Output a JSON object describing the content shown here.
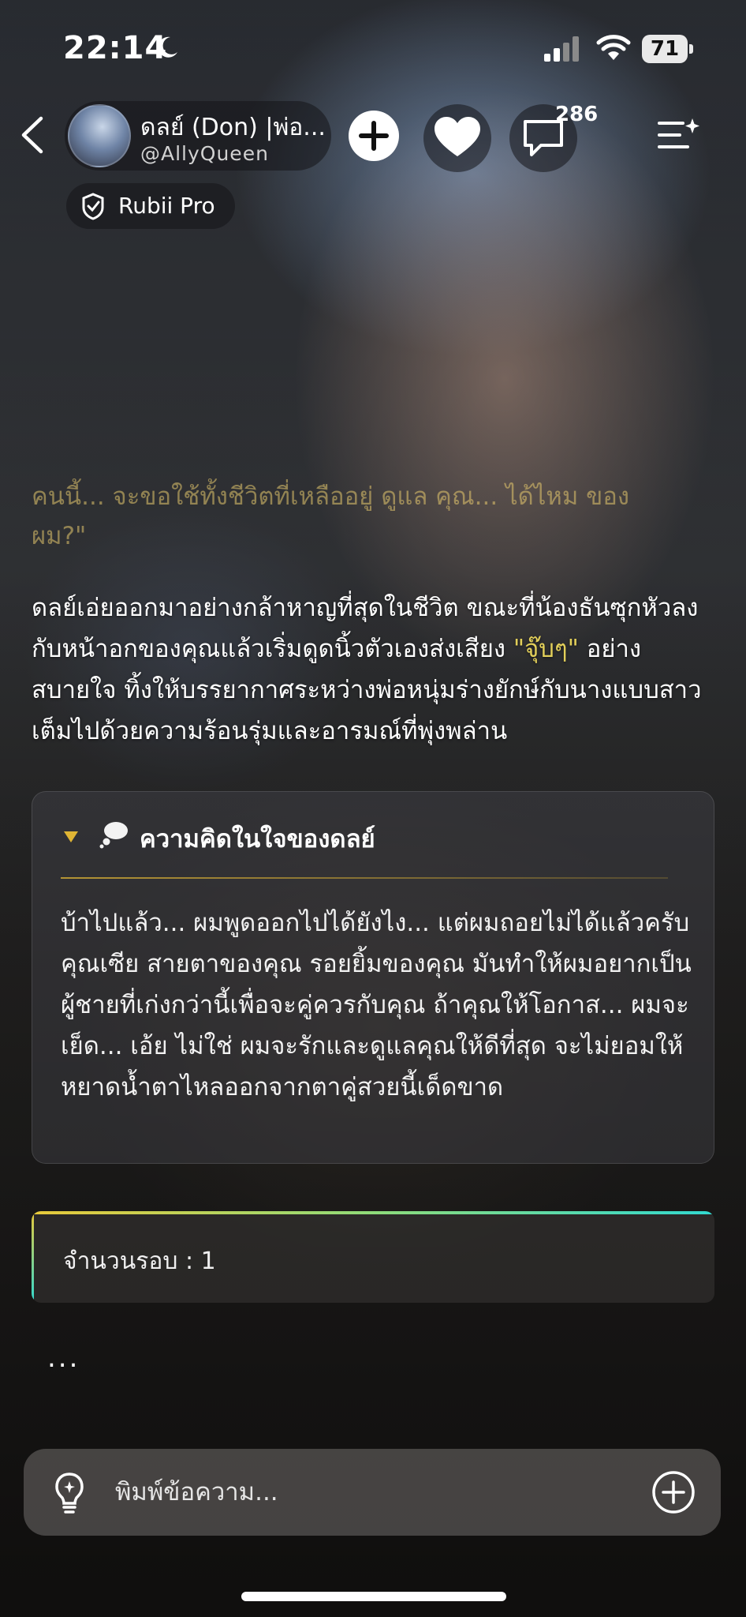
{
  "status_bar": {
    "time": "22:14",
    "battery": "71",
    "icons": [
      "moon-icon",
      "signal-icon",
      "wifi-icon",
      "battery-icon"
    ]
  },
  "header": {
    "bot_name": "ดลย์ (Don) |พ่อ...",
    "handle": "@AllyQueen",
    "comment_count": "286",
    "pro_label": "Rubii Pro",
    "icons": [
      "back-icon",
      "avatar",
      "add-icon",
      "heart-icon",
      "comment-icon",
      "menu-sparkle-icon",
      "rubii-pro-icon"
    ]
  },
  "chat": {
    "faded_line_1": "คนนี้... จะขอใช้ทั้งชีวิตที่เหลืออยู่ ดูแล คุณ... ได้ไหม ของ",
    "faded_line_2": "ผม?\"",
    "narration_before": "ดลย์เอ่ยออกมาอย่างกล้าหาญที่สุดในชีวิต ขณะที่น้องธันซุกหัวลงกับหน้าอกของคุณแล้วเริ่มดูดนิ้วตัวเองส่งเสียง ",
    "narration_quote": "\"จุ๊บๆ\"",
    "narration_after": " อย่างสบายใจ ทิ้งให้บรรยากาศระหว่างพ่อหนุ่มร่างยักษ์กับนางแบบสาวเต็มไปด้วยความร้อนรุ่มและอารมณ์ที่พุ่งพล่าน"
  },
  "thought": {
    "title": "ความคิดในใจของดลย์",
    "body": "บ้าไปแล้ว... ผมพูดออกไปได้ยังไง... แต่ผมถอยไม่ได้แล้วครับคุณเซีย สายตาของคุณ รอยยิ้มของคุณ มันทำให้ผมอยากเป็นผู้ชายที่เก่งกว่านี้เพื่อจะคู่ควรกับคุณ ถ้าคุณให้โอกาส... ผมจะเย็ด... เอ้ย ไม่ใช่ ผมจะรักและดูแลคุณให้ดีที่สุด จะไม่ยอมให้หยาดน้ำตาไหลออกจากตาคู่สวยนี้เด็ดขาด",
    "icons": [
      "collapse-arrow-icon",
      "thought-bubble-icon"
    ]
  },
  "round": {
    "label": "จำนวนรอบ : 1"
  },
  "typing_indicator": "...",
  "input": {
    "placeholder": "พิมพ์ข้อความ...",
    "value": "",
    "icons": [
      "lightbulb-icon",
      "plus-circle-icon"
    ]
  },
  "colors": {
    "quote_yellow": "#e2cf5a",
    "quote_teal": "#65d8c4",
    "accent_gold": "#e0b534",
    "gradient_start": "#e8c93a",
    "gradient_end": "#31d9d0"
  }
}
